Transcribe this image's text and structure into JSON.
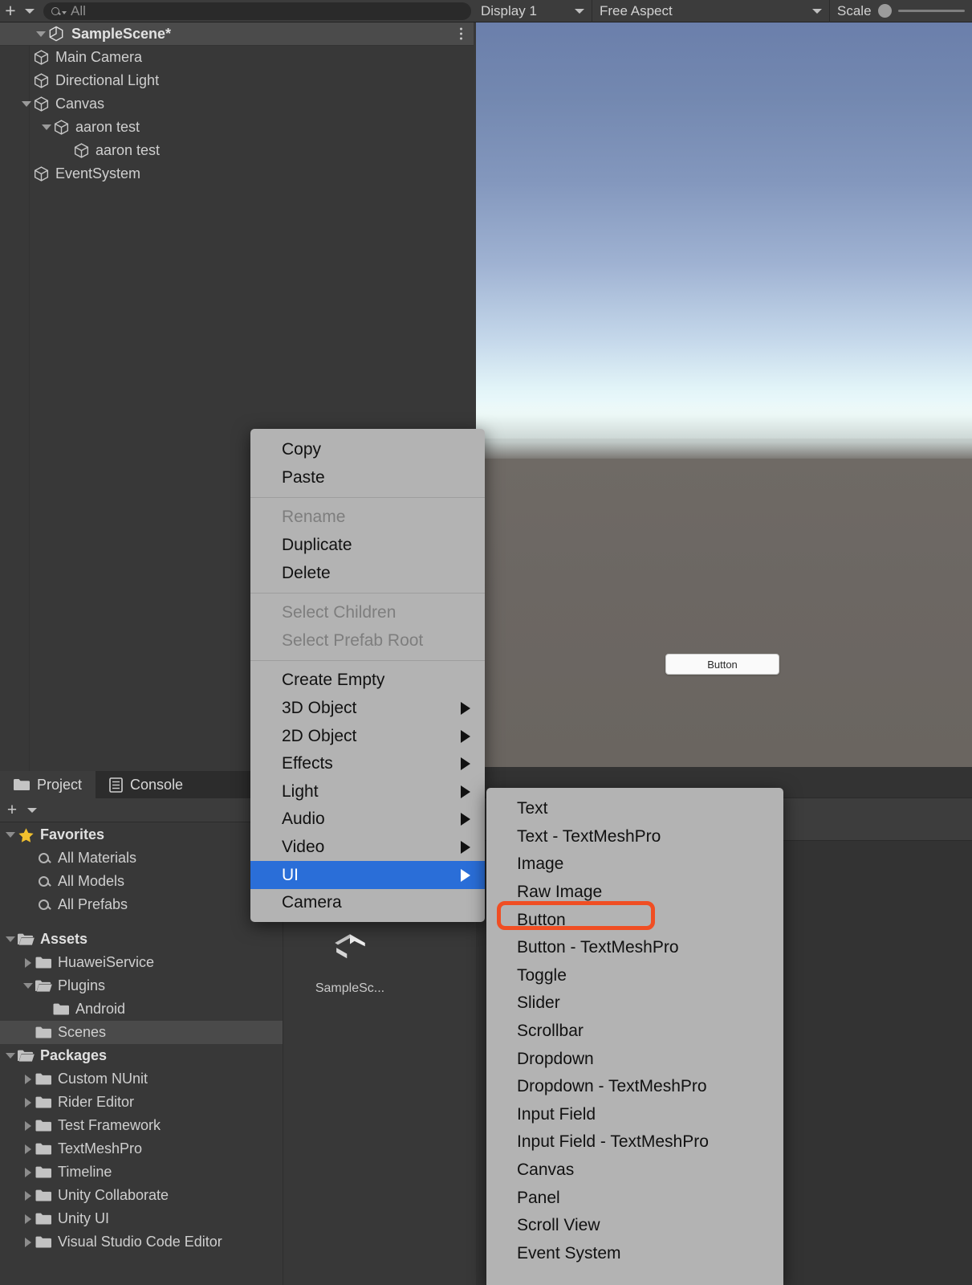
{
  "app": "Unity Editor",
  "hierarchy_toolbar": {
    "add_label": "+",
    "search_placeholder": "All",
    "search_value": "",
    "add_icon": "plus-icon",
    "dropdown_icon": "chevron-down-icon",
    "search_icon": "search-icon"
  },
  "game_toolbar": {
    "display": "Display 1",
    "aspect": "Free Aspect",
    "scale_label": "Scale",
    "scale_value": 1,
    "display_caret_icon": "chevron-down-icon",
    "aspect_caret_icon": "chevron-down-icon"
  },
  "hierarchy": {
    "scene_name": "SampleScene*",
    "scene_icon": "unity-logo-icon",
    "menu_icon": "kebab-menu-icon",
    "items": [
      {
        "label": "Main Camera",
        "depth": 1,
        "expand": "none",
        "icon": "gameobject-cube-icon"
      },
      {
        "label": "Directional Light",
        "depth": 1,
        "expand": "none",
        "icon": "gameobject-cube-icon"
      },
      {
        "label": "Canvas",
        "depth": 1,
        "expand": "open",
        "icon": "gameobject-cube-icon"
      },
      {
        "label": "aaron test",
        "depth": 2,
        "expand": "open",
        "icon": "gameobject-cube-icon"
      },
      {
        "label": "aaron test",
        "depth": 3,
        "expand": "none",
        "icon": "gameobject-cube-icon"
      },
      {
        "label": "EventSystem",
        "depth": 1,
        "expand": "none",
        "icon": "gameobject-cube-icon"
      }
    ]
  },
  "game_view": {
    "button_label": "Button"
  },
  "project": {
    "tabs": [
      {
        "label": "Project",
        "icon": "folder-icon",
        "active": true
      },
      {
        "label": "Console",
        "icon": "console-icon",
        "active": false
      }
    ],
    "add_label": "+",
    "add_icon": "plus-icon",
    "dropdown_icon": "chevron-down-icon",
    "tree": [
      {
        "label": "Favorites",
        "depth": 0,
        "expand": "open",
        "icon": "star-icon",
        "bold": true,
        "selected": false
      },
      {
        "label": "All Materials",
        "depth": 1,
        "expand": "none",
        "icon": "search-icon",
        "bold": false,
        "selected": false
      },
      {
        "label": "All Models",
        "depth": 1,
        "expand": "none",
        "icon": "search-icon",
        "bold": false,
        "selected": false
      },
      {
        "label": "All Prefabs",
        "depth": 1,
        "expand": "none",
        "icon": "search-icon",
        "bold": false,
        "selected": false
      },
      {
        "label": "",
        "depth": 0,
        "expand": "none",
        "icon": "spacer",
        "bold": false,
        "selected": false
      },
      {
        "label": "Assets",
        "depth": 0,
        "expand": "open",
        "icon": "folder-open-icon",
        "bold": true,
        "selected": false
      },
      {
        "label": "HuaweiService",
        "depth": 1,
        "expand": "closed",
        "icon": "folder-icon",
        "bold": false,
        "selected": false
      },
      {
        "label": "Plugins",
        "depth": 1,
        "expand": "open",
        "icon": "folder-open-icon",
        "bold": false,
        "selected": false
      },
      {
        "label": "Android",
        "depth": 2,
        "expand": "none",
        "icon": "folder-icon",
        "bold": false,
        "selected": false
      },
      {
        "label": "Scenes",
        "depth": 1,
        "expand": "none",
        "icon": "folder-icon",
        "bold": false,
        "selected": true
      },
      {
        "label": "Packages",
        "depth": 0,
        "expand": "open",
        "icon": "folder-open-icon",
        "bold": true,
        "selected": false
      },
      {
        "label": "Custom NUnit",
        "depth": 1,
        "expand": "closed",
        "icon": "folder-icon",
        "bold": false,
        "selected": false
      },
      {
        "label": "Rider Editor",
        "depth": 1,
        "expand": "closed",
        "icon": "folder-icon",
        "bold": false,
        "selected": false
      },
      {
        "label": "Test Framework",
        "depth": 1,
        "expand": "closed",
        "icon": "folder-icon",
        "bold": false,
        "selected": false
      },
      {
        "label": "TextMeshPro",
        "depth": 1,
        "expand": "closed",
        "icon": "folder-icon",
        "bold": false,
        "selected": false
      },
      {
        "label": "Timeline",
        "depth": 1,
        "expand": "closed",
        "icon": "folder-icon",
        "bold": false,
        "selected": false
      },
      {
        "label": "Unity Collaborate",
        "depth": 1,
        "expand": "closed",
        "icon": "folder-icon",
        "bold": false,
        "selected": false
      },
      {
        "label": "Unity UI",
        "depth": 1,
        "expand": "closed",
        "icon": "folder-icon",
        "bold": false,
        "selected": false
      },
      {
        "label": "Visual Studio Code Editor",
        "depth": 1,
        "expand": "closed",
        "icon": "folder-icon",
        "bold": false,
        "selected": false
      }
    ],
    "asset": {
      "label": "SampleSc...",
      "icon": "unity-scene-icon"
    }
  },
  "context_menu": {
    "groups": [
      {
        "items": [
          {
            "label": "Copy",
            "disabled": false,
            "submenu": false,
            "selected": false
          },
          {
            "label": "Paste",
            "disabled": false,
            "submenu": false,
            "selected": false
          }
        ]
      },
      {
        "items": [
          {
            "label": "Rename",
            "disabled": true,
            "submenu": false,
            "selected": false
          },
          {
            "label": "Duplicate",
            "disabled": false,
            "submenu": false,
            "selected": false
          },
          {
            "label": "Delete",
            "disabled": false,
            "submenu": false,
            "selected": false
          }
        ]
      },
      {
        "items": [
          {
            "label": "Select Children",
            "disabled": true,
            "submenu": false,
            "selected": false
          },
          {
            "label": "Select Prefab Root",
            "disabled": true,
            "submenu": false,
            "selected": false
          }
        ]
      },
      {
        "items": [
          {
            "label": "Create Empty",
            "disabled": false,
            "submenu": false,
            "selected": false
          },
          {
            "label": "3D Object",
            "disabled": false,
            "submenu": true,
            "selected": false
          },
          {
            "label": "2D Object",
            "disabled": false,
            "submenu": true,
            "selected": false
          },
          {
            "label": "Effects",
            "disabled": false,
            "submenu": true,
            "selected": false
          },
          {
            "label": "Light",
            "disabled": false,
            "submenu": true,
            "selected": false
          },
          {
            "label": "Audio",
            "disabled": false,
            "submenu": true,
            "selected": false
          },
          {
            "label": "Video",
            "disabled": false,
            "submenu": true,
            "selected": false
          },
          {
            "label": "UI",
            "disabled": false,
            "submenu": true,
            "selected": true
          },
          {
            "label": "Camera",
            "disabled": false,
            "submenu": false,
            "selected": false
          }
        ]
      }
    ]
  },
  "submenu": {
    "parent": "UI",
    "highlighted": "Button",
    "highlight_color": "#f04e23",
    "items": [
      "Text",
      "Text - TextMeshPro",
      "Image",
      "Raw Image",
      "Button",
      "Button - TextMeshPro",
      "Toggle",
      "Slider",
      "Scrollbar",
      "Dropdown",
      "Dropdown - TextMeshPro",
      "Input Field",
      "Input Field - TextMeshPro",
      "Canvas",
      "Panel",
      "Scroll View",
      "Event System"
    ]
  },
  "colors": {
    "panel_bg": "#383838",
    "toolbar_bg": "#3c3c3c",
    "menu_bg": "#b3b3b3",
    "menu_highlight": "#2a6ed8",
    "annotation": "#f04e23",
    "row_selected": "#4a4a4a"
  }
}
